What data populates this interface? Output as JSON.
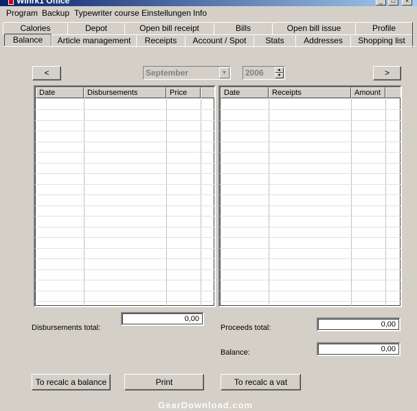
{
  "window": {
    "title": "Winrk1 Office"
  },
  "menu": [
    "Program",
    "Backup",
    "Typewriter course",
    "Einstellungen",
    "Info"
  ],
  "tabs_row1": [
    "Calories",
    "Depot",
    "Open bill receipt",
    "Bills",
    "Open bill issue",
    "Profile"
  ],
  "tabs_row2": [
    "Balance",
    "Article management",
    "Receipts",
    "Account / Spot",
    "Stats",
    "Addresses",
    "Shopping list"
  ],
  "active_tab": "Balance",
  "nav": {
    "prev": "<",
    "next": ">",
    "month": "September",
    "year": "2006"
  },
  "disbursements_table": {
    "headers": [
      "Date",
      "Disbursements",
      "Price"
    ],
    "rows": []
  },
  "receipts_table": {
    "headers": [
      "Date",
      "Receipts",
      "Amount"
    ],
    "rows": []
  },
  "totals": {
    "disbursements_label": "Disbursements total:",
    "disbursements_value": "0,00",
    "proceeds_label": "Proceeds total:",
    "proceeds_value": "0,00",
    "balance_label": "Balance:",
    "balance_value": "0,00"
  },
  "buttons": {
    "recalc_balance": "To recalc a balance",
    "print": "Print",
    "recalc_vat": "To recalc a vat"
  },
  "watermark": "GearDownload.com"
}
